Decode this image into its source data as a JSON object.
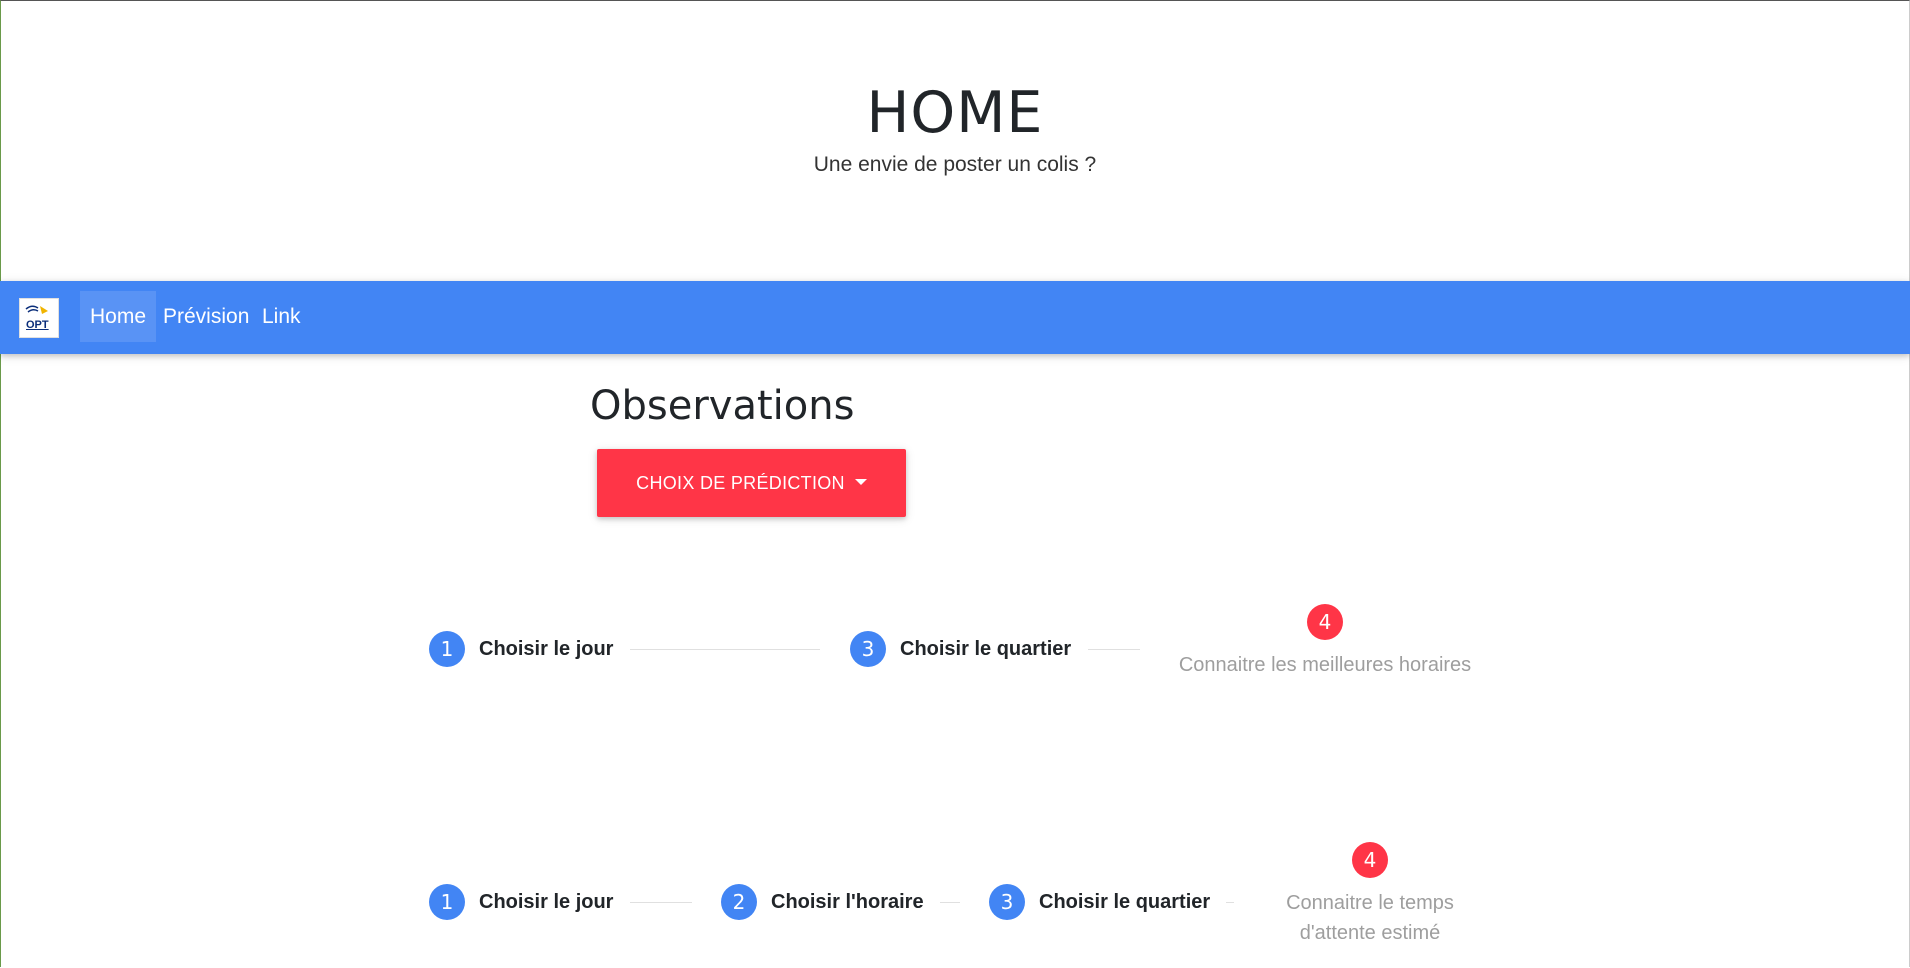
{
  "hero": {
    "title": "HOME",
    "subtitle": "Une envie de poster un colis ?"
  },
  "navbar": {
    "logo_text": "OPT",
    "items": [
      {
        "label": "Home",
        "active": true
      },
      {
        "label": "Prévision",
        "active": false
      },
      {
        "label": "Link",
        "active": false
      }
    ],
    "background_color": "#4285f4"
  },
  "main": {
    "title": "Observations",
    "dropdown_label": "CHOIX DE PRÉDICTION",
    "dropdown_color": "#ff3547"
  },
  "stepper1": {
    "steps": [
      {
        "number": "1",
        "label": "Choisir le jour"
      },
      {
        "number": "3",
        "label": "Choisir le quartier"
      }
    ],
    "final": {
      "number": "4",
      "label": "Connaitre les meilleures horaires"
    }
  },
  "stepper2": {
    "steps": [
      {
        "number": "1",
        "label": "Choisir le jour"
      },
      {
        "number": "2",
        "label": "Choisir l'horaire"
      },
      {
        "number": "3",
        "label": "Choisir le quartier"
      }
    ],
    "final": {
      "number": "4",
      "label_line1": "Connaitre le temps",
      "label_line2": "d'attente estimé"
    }
  },
  "colors": {
    "primary": "#4285f4",
    "danger": "#ff3547",
    "muted": "#9e9e9e"
  }
}
